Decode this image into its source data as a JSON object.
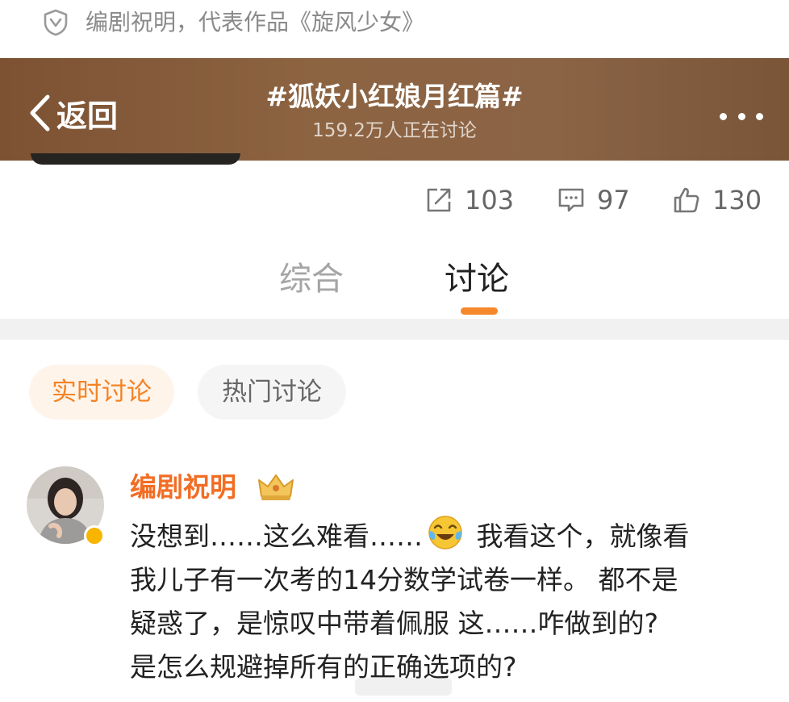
{
  "verification": {
    "icon": "verified-shield-icon",
    "text": "编剧祝明，代表作品《旋风少女》"
  },
  "header": {
    "back_label": "返回",
    "title": "#狐妖小红娘月红篇#",
    "subtitle": "159.2万人正在讨论",
    "more_icon": "more-dots-icon",
    "bg_color": "#8a6142"
  },
  "stats": {
    "repost": "103",
    "comment": "97",
    "like": "130"
  },
  "tabs": [
    {
      "label": "综合"
    },
    {
      "label": "讨论"
    }
  ],
  "filters": [
    {
      "label": "实时讨论"
    },
    {
      "label": "热门讨论"
    }
  ],
  "post": {
    "author": "编剧祝明",
    "lines": [
      "没想到……这么难看……",
      " 我看这个，就像看",
      "我儿子有一次考的14分数学试卷一样。 都不是",
      "疑惑了，是惊叹中带着佩服 这……咋做到的?",
      "是怎么规避掉所有的正确选项的?"
    ]
  },
  "colors": {
    "accent": "#f5882a",
    "author": "#f26d24"
  }
}
